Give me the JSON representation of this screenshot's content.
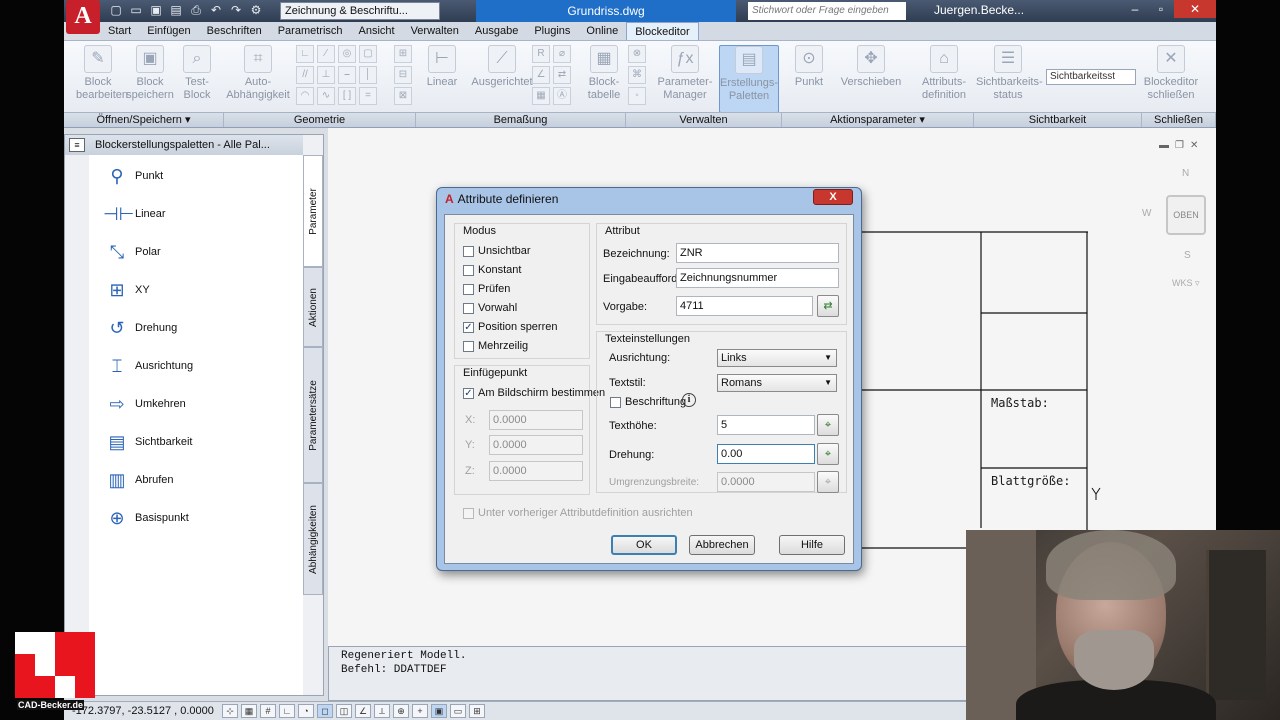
{
  "titlebar": {
    "app_button": "A",
    "workspace": "Zeichnung & Beschriftu...",
    "document_title": "Grundriss.dwg",
    "search_placeholder": "Stichwort oder Frage eingeben",
    "user": "Juergen.Becke..."
  },
  "menu_tabs": [
    "Start",
    "Einfügen",
    "Beschriften",
    "Parametrisch",
    "Ansicht",
    "Verwalten",
    "Ausgabe",
    "Plugins",
    "Online",
    "Blockeditor"
  ],
  "active_tab": "Blockeditor",
  "ribbon": {
    "block_bearbeiten": [
      "Block",
      "bearbeiten"
    ],
    "block_speichern": [
      "Block",
      "speichern"
    ],
    "test_block": [
      "Test-",
      "Block"
    ],
    "auto_abh": [
      "Auto-",
      "Abhängigkeit"
    ],
    "linear": "Linear",
    "ausgerichtet": "Ausgerichtet",
    "blocktabelle": [
      "Block-",
      "tabelle"
    ],
    "param_manager": [
      "Parameter-",
      "Manager"
    ],
    "erstellungs_paletten": [
      "Erstellungs-",
      "Paletten"
    ],
    "punkt": "Punkt",
    "verschieben": "Verschieben",
    "attributdef": [
      "Attributs-",
      "definition"
    ],
    "sichtbarkeitsstatus": [
      "Sichtbarkeits-",
      "status"
    ],
    "sichtbarkeit_select": "Sichtbarkeitsst",
    "blockeditor_schliessen": [
      "Blockeditor",
      "schließen"
    ],
    "panels": [
      "Öffnen/Speichern ▾",
      "Geometrie",
      "Bemaßung",
      "Verwalten",
      "Aktionsparameter ▾",
      "Sichtbarkeit",
      "Schließen"
    ]
  },
  "palette": {
    "title": "Blockerstellungspaletten - Alle Pal...",
    "items": [
      "Punkt",
      "Linear",
      "Polar",
      "XY",
      "Drehung",
      "Ausrichtung",
      "Umkehren",
      "Sichtbarkeit",
      "Abrufen",
      "Basispunkt"
    ],
    "tabs": [
      "Parameter",
      "Aktionen",
      "Parametersätze",
      "Abhängigkeiten"
    ]
  },
  "canvas": {
    "massstab": "Maßstab:",
    "blattgroesse": "Blattgröße:",
    "compass": {
      "n": "N",
      "s": "S",
      "w": "W",
      "o": "O",
      "top": "OBEN",
      "wcs": "WKS ▿"
    }
  },
  "command": {
    "line1": "Regeneriert Modell.",
    "line2": "Befehl:  DDATTDEF"
  },
  "status": {
    "coords": "-172.3797, -23.5127 , 0.0000"
  },
  "dialog": {
    "title": "Attribute definieren",
    "close": "X",
    "modus": {
      "title": "Modus",
      "items": [
        {
          "label": "Unsichtbar",
          "checked": false
        },
        {
          "label": "Konstant",
          "checked": false
        },
        {
          "label": "Prüfen",
          "checked": false
        },
        {
          "label": "Vorwahl",
          "checked": false
        },
        {
          "label": "Position sperren",
          "checked": true
        },
        {
          "label": "Mehrzeilig",
          "checked": false
        }
      ]
    },
    "einfuegepunkt": {
      "title": "Einfügepunkt",
      "on_screen": "Am Bildschirm bestimmen",
      "on_screen_checked": true,
      "x_label": "X:",
      "x": "0.0000",
      "y_label": "Y:",
      "y": "0.0000",
      "z_label": "Z:",
      "z": "0.0000"
    },
    "attribut": {
      "title": "Attribut",
      "bezeichnung_label": "Bezeichnung:",
      "bezeichnung": "ZNR",
      "eingabe_label": "Eingabeaufford.:",
      "eingabe": "Zeichnungsnummer",
      "vorgabe_label": "Vorgabe:",
      "vorgabe": "4711"
    },
    "text": {
      "title": "Texteinstellungen",
      "ausrichtung_label": "Ausrichtung:",
      "ausrichtung": "Links",
      "textstil_label": "Textstil:",
      "textstil": "Romans",
      "beschriftung": "Beschriftung",
      "beschriftung_checked": false,
      "texthoehe_label": "Texthöhe:",
      "texthoehe": "5",
      "drehung_label": "Drehung:",
      "drehung": "0.00",
      "umgrenzung_label": "Umgrenzungsbreite:",
      "umgrenzung": "0.0000"
    },
    "under_prev": "Unter vorheriger Attributdefinition ausrichten",
    "ok": "OK",
    "cancel": "Abbrechen",
    "help": "Hilfe"
  },
  "watermark": "CAD-Becker.de",
  "colors": {
    "accent": "#1f6fc8",
    "brand_red": "#e8141e",
    "dialog_frame": "#a8c4e6"
  }
}
